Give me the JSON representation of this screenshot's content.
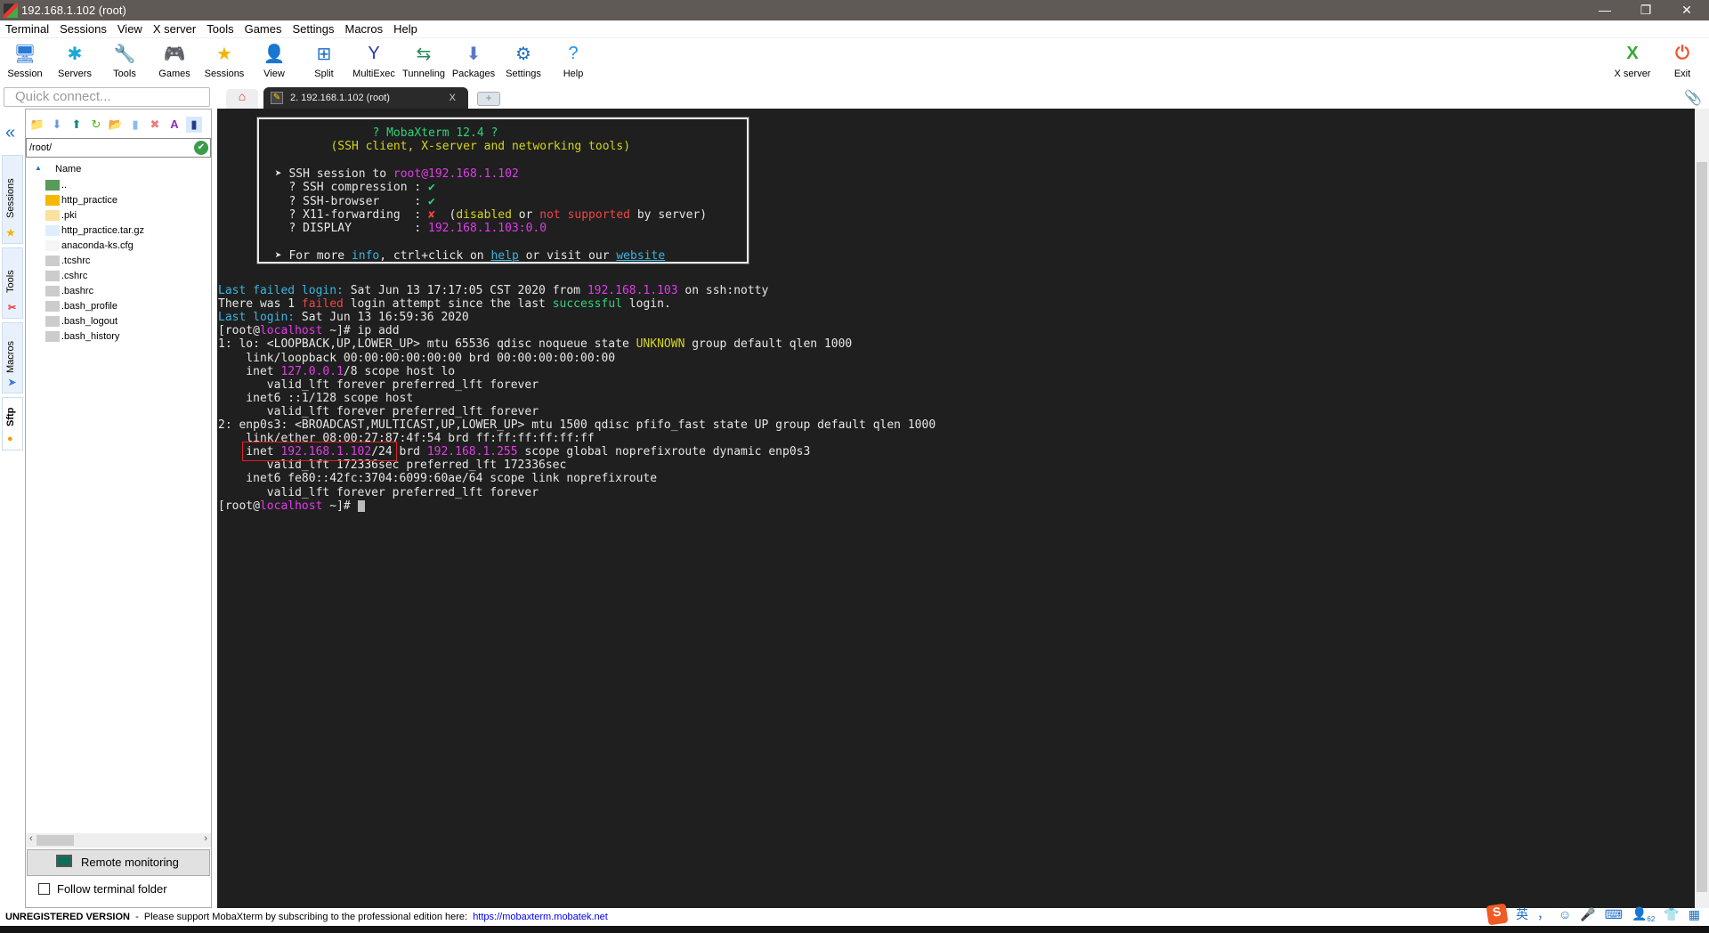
{
  "window": {
    "title": "192.168.1.102 (root)",
    "minimize": "—",
    "restore": "❐",
    "close": "✕"
  },
  "menu": [
    "Terminal",
    "Sessions",
    "View",
    "X server",
    "Tools",
    "Games",
    "Settings",
    "Macros",
    "Help"
  ],
  "toolbar": [
    {
      "label": "Session",
      "icon": "session-icon",
      "glyph": "🖥"
    },
    {
      "label": "Servers",
      "icon": "servers-icon",
      "glyph": "✱"
    },
    {
      "label": "Tools",
      "icon": "tools-icon",
      "glyph": "🔧"
    },
    {
      "label": "Games",
      "icon": "games-icon",
      "glyph": "🎮"
    },
    {
      "label": "Sessions",
      "icon": "star-icon",
      "glyph": "★"
    },
    {
      "label": "View",
      "icon": "view-icon",
      "glyph": "👤"
    },
    {
      "label": "Split",
      "icon": "split-icon",
      "glyph": "⊞"
    },
    {
      "label": "MultiExec",
      "icon": "multiexec-icon",
      "glyph": "Y"
    },
    {
      "label": "Tunneling",
      "icon": "tunneling-icon",
      "glyph": "⇆"
    },
    {
      "label": "Packages",
      "icon": "packages-icon",
      "glyph": "⬇"
    },
    {
      "label": "Settings",
      "icon": "settings-icon",
      "glyph": "⚙"
    },
    {
      "label": "Help",
      "icon": "help-icon",
      "glyph": "?"
    }
  ],
  "toolbar_right": [
    {
      "label": "X server",
      "glyph": "X"
    },
    {
      "label": "Exit",
      "glyph": "⏻"
    }
  ],
  "quick_connect": {
    "placeholder": "Quick connect..."
  },
  "tabs": {
    "home_glyph": "⌂",
    "active": "2. 192.168.1.102 (root)",
    "close": "X",
    "new": "+"
  },
  "side_tabs": [
    "Sessions",
    "Tools",
    "Macros",
    "Sftp"
  ],
  "sftp": {
    "path": "/root/",
    "column_name": "Name",
    "files": [
      {
        "name": "..",
        "type": "up"
      },
      {
        "name": "http_practice",
        "type": "folder"
      },
      {
        "name": ".pki",
        "type": "folder-light"
      },
      {
        "name": "http_practice.tar.gz",
        "type": "archive"
      },
      {
        "name": "anaconda-ks.cfg",
        "type": "cfg"
      },
      {
        "name": ".tcshrc",
        "type": "script"
      },
      {
        "name": ".cshrc",
        "type": "script"
      },
      {
        "name": ".bashrc",
        "type": "script"
      },
      {
        "name": ".bash_profile",
        "type": "script"
      },
      {
        "name": ".bash_logout",
        "type": "script"
      },
      {
        "name": ".bash_history",
        "type": "script"
      }
    ],
    "remote_monitoring": "Remote monitoring",
    "follow_folder": "Follow terminal folder"
  },
  "colors": {
    "w": "#e6e6e6",
    "c": "#39b5e0",
    "m": "#e03ce8",
    "y": "#d4d41c",
    "r": "#f04545",
    "g": "#2ed47a",
    "gr": "#2ed47a"
  },
  "banner": [
    {
      "indent": 15,
      "segs": [
        [
          "? MobaXterm 12.4 ?",
          "g"
        ]
      ]
    },
    {
      "indent": 9,
      "segs": [
        [
          "(SSH client, X-server and networking tools)",
          "y"
        ]
      ]
    },
    {
      "indent": 0,
      "segs": [
        [
          "",
          ""
        ]
      ]
    },
    {
      "indent": 1,
      "segs": [
        [
          "➤ SSH session to ",
          "w"
        ],
        [
          "root",
          "m"
        ],
        [
          "@192.168.1.102",
          "m"
        ]
      ]
    },
    {
      "indent": 1,
      "segs": [
        [
          "  ? SSH compression : ",
          "w"
        ],
        [
          "✔",
          "g"
        ]
      ]
    },
    {
      "indent": 1,
      "segs": [
        [
          "  ? SSH-browser     : ",
          "w"
        ],
        [
          "✔",
          "g"
        ]
      ]
    },
    {
      "indent": 1,
      "segs": [
        [
          "  ? X11-forwarding  : ",
          "w"
        ],
        [
          "✘",
          "r"
        ],
        [
          "  (",
          "w"
        ],
        [
          "disabled",
          "y"
        ],
        [
          " or ",
          "w"
        ],
        [
          "not supported",
          "r"
        ],
        [
          " by server)",
          "w"
        ]
      ]
    },
    {
      "indent": 1,
      "segs": [
        [
          "  ? DISPLAY         : ",
          "w"
        ],
        [
          "192.168.1.103:0.0",
          "m"
        ]
      ]
    },
    {
      "indent": 0,
      "segs": [
        [
          "",
          ""
        ]
      ]
    },
    {
      "indent": 1,
      "segs": [
        [
          "➤ For more ",
          "w"
        ],
        [
          "info",
          "c"
        ],
        [
          ", ctrl+click on ",
          "w"
        ],
        [
          "help",
          "cu"
        ],
        [
          " or visit our ",
          "w"
        ],
        [
          "website",
          "cu"
        ]
      ]
    }
  ],
  "terminal": [
    [
      [
        "Last failed login:",
        "c"
      ],
      [
        " Sat Jun 13 17:17:05 CST 2020 from ",
        "w"
      ],
      [
        "192.168.1.103",
        "m"
      ],
      [
        " on ssh:notty",
        "w"
      ]
    ],
    [
      [
        "There was 1 ",
        "w"
      ],
      [
        "failed",
        "r"
      ],
      [
        " login attempt since the last ",
        "w"
      ],
      [
        "successful",
        "g"
      ],
      [
        " login.",
        "w"
      ]
    ],
    [
      [
        "Last login:",
        "c"
      ],
      [
        " Sat Jun 13 16:59:36 2020",
        "w"
      ]
    ],
    [
      [
        "[root@",
        "w"
      ],
      [
        "localhost",
        "m"
      ],
      [
        " ~]# ip add",
        "w"
      ]
    ],
    [
      [
        "1: lo: <LOOPBACK,UP,LOWER_UP> mtu 65536 qdisc noqueue state ",
        "w"
      ],
      [
        "UNKNOWN",
        "y"
      ],
      [
        " group default qlen 1000",
        "w"
      ]
    ],
    [
      [
        "    link/loopback 00:00:00:00:00:00 brd 00:00:00:00:00:00",
        "w"
      ]
    ],
    [
      [
        "    inet ",
        "w"
      ],
      [
        "127.0.0.1",
        "m"
      ],
      [
        "/8 scope host lo",
        "w"
      ]
    ],
    [
      [
        "       valid_lft forever preferred_lft forever",
        "w"
      ]
    ],
    [
      [
        "    inet6 ::1/128 scope host",
        "w"
      ]
    ],
    [
      [
        "       valid_lft forever preferred_lft forever",
        "w"
      ]
    ],
    [
      [
        "2: enp0s3: <BROADCAST,MULTICAST,UP,LOWER_UP> mtu 1500 qdisc pfifo_fast state UP group default qlen 1000",
        "w"
      ]
    ],
    [
      [
        "    link/ether 08:00:27:87:4f:54 brd ff:ff:ff:ff:ff:ff",
        "w"
      ]
    ],
    [
      [
        "    inet ",
        "w"
      ],
      [
        "192.168.1.102",
        "m"
      ],
      [
        "/24 brd ",
        "w"
      ],
      [
        "192.168.1.255",
        "m"
      ],
      [
        " scope global noprefixroute dynamic enp0s3",
        "w"
      ]
    ],
    [
      [
        "       valid_lft 172336sec preferred_lft 172336sec",
        "w"
      ]
    ],
    [
      [
        "    inet6 fe80::42fc:3704:6099:60ae/64 scope link noprefixroute",
        "w"
      ]
    ],
    [
      [
        "       valid_lft forever preferred_lft forever",
        "w"
      ]
    ],
    [
      [
        "[root@",
        "w"
      ],
      [
        "localhost",
        "m"
      ],
      [
        " ~]# ",
        "w"
      ]
    ]
  ],
  "status": {
    "bold": "UNREGISTERED VERSION",
    "text": "  -  Please support MobaXterm by subscribing to the professional edition here:  ",
    "link": "https://mobaxterm.mobatek.net"
  },
  "tray": {
    "ime": "S",
    "lang": "英",
    "punct": "，",
    "badge": "62"
  }
}
